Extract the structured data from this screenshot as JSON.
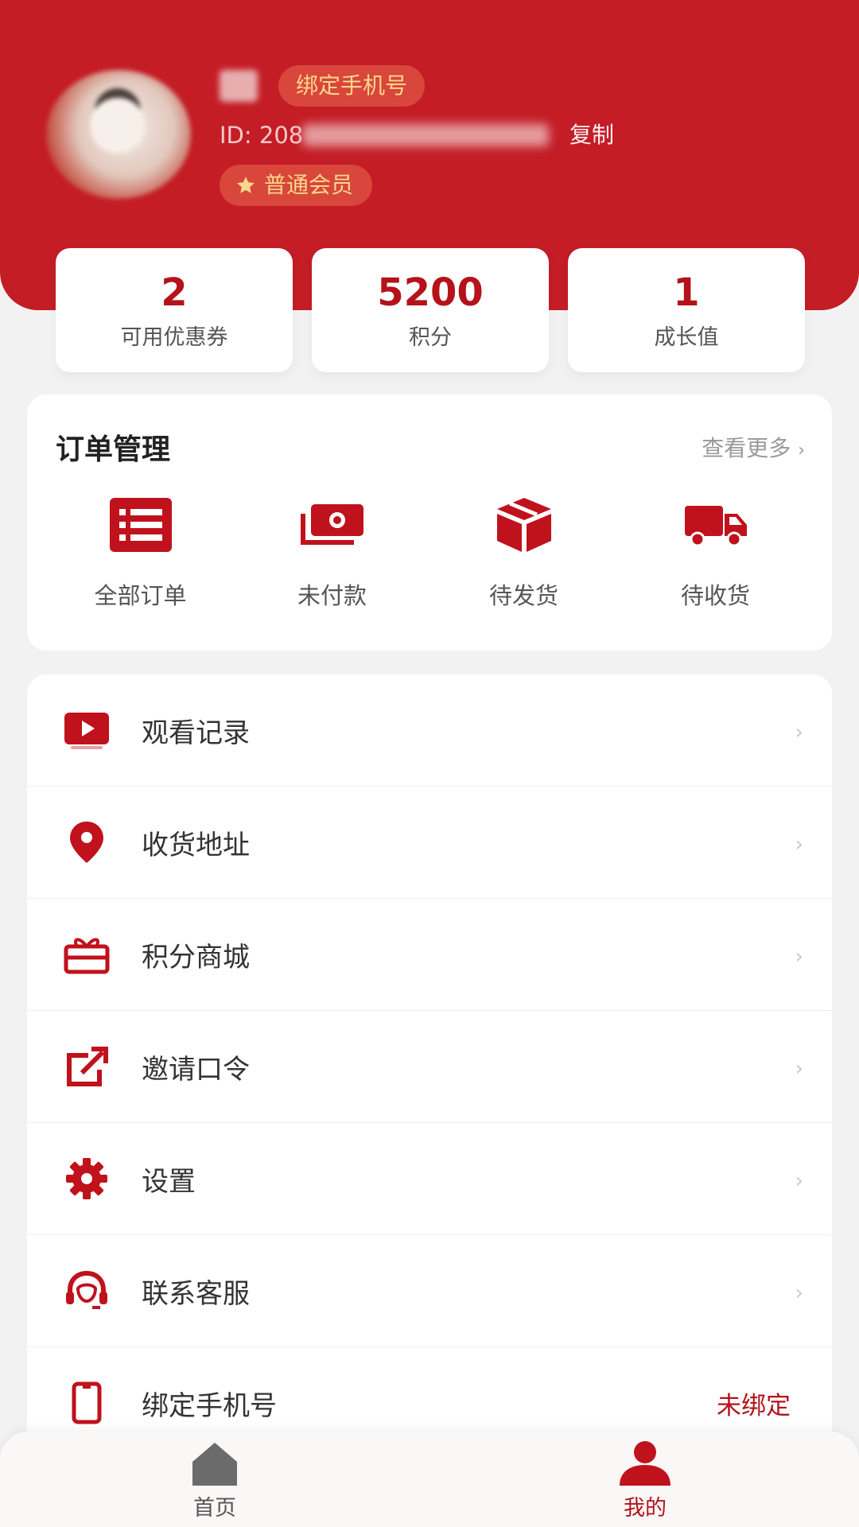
{
  "profile": {
    "nickname": "昵",
    "bind_phone_badge": "绑定手机号",
    "user_id": "ID: 208",
    "copy_label": "复制",
    "member_level": "普通会员"
  },
  "stats": [
    {
      "value": "2",
      "label": "可用优惠券"
    },
    {
      "value": "5200",
      "label": "积分"
    },
    {
      "value": "1",
      "label": "成长值"
    }
  ],
  "orders": {
    "title": "订单管理",
    "more_label": "查看更多",
    "items": [
      {
        "label": "全部订单",
        "icon": "order-list-icon"
      },
      {
        "label": "未付款",
        "icon": "cash-icon"
      },
      {
        "label": "待发货",
        "icon": "box-icon"
      },
      {
        "label": "待收货",
        "icon": "truck-icon"
      }
    ]
  },
  "menu": [
    {
      "label": "观看记录",
      "icon": "play-icon"
    },
    {
      "label": "收货地址",
      "icon": "location-icon"
    },
    {
      "label": "积分商城",
      "icon": "gift-icon"
    },
    {
      "label": "邀请口令",
      "icon": "share-icon"
    },
    {
      "label": "设置",
      "icon": "gear-icon"
    },
    {
      "label": "联系客服",
      "icon": "headset-icon"
    },
    {
      "label": "绑定手机号",
      "icon": "phone-icon",
      "status": "未绑定"
    }
  ],
  "tabbar": [
    {
      "label": "首页",
      "icon": "home-icon",
      "active": false
    },
    {
      "label": "我的",
      "icon": "user-icon",
      "active": true
    }
  ],
  "colors": {
    "brand": "#c41d26",
    "accent": "#b5121b",
    "badge_text": "#f9d78b"
  }
}
